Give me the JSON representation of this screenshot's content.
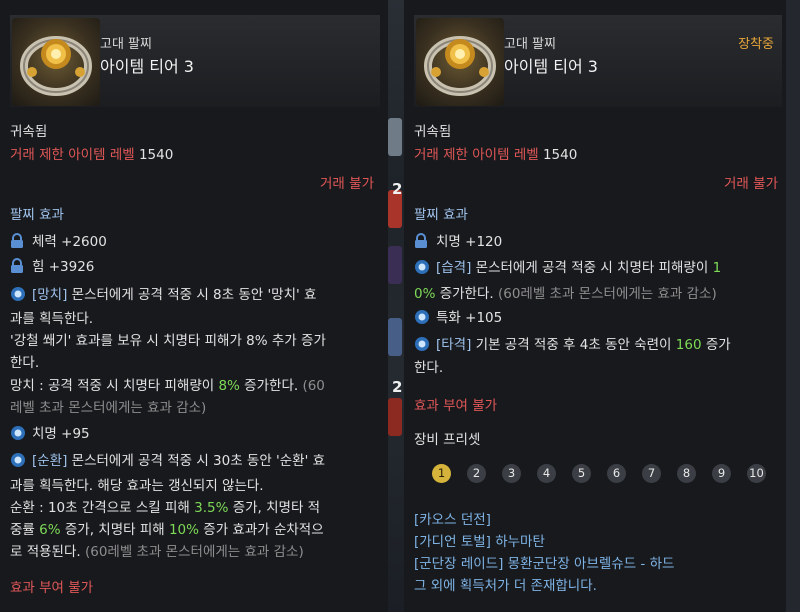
{
  "background": {
    "numbers": [
      "2",
      "2"
    ]
  },
  "left": {
    "category": "고대 팔찌",
    "tier": "아이템 티어 3",
    "bound": "귀속됨",
    "trade_level_label": "거래 제한 아이템 레벨",
    "trade_level_value": "1540",
    "trade_status": "거래 불가",
    "effects_header": "팔찌 효과",
    "stat1": "체력 +2600",
    "stat2": "힘 +3926",
    "e1_tag": "[망치]",
    "e1_text_a": " 몬스터에게 공격 적중 시 8초 동안 '망치' 효",
    "e1_text_b": "과를 획득한다.",
    "e1_text_c": "'강철 쐐기' 효과를 보유 시 치명타 피해가 8% 추가 증가",
    "e1_text_d": "한다.",
    "e1_text_e_pre": "망치 : 공격 적중 시 치명타 피해량이 ",
    "e1_text_e_val": "8%",
    "e1_text_e_post": " 증가한다.",
    "e1_text_e_note": " (60",
    "e1_text_f": "레벨 초과 몬스터에게는 효과 감소)",
    "stat3": "치명 +95",
    "e2_tag": "[순환]",
    "e2_text_a": " 몬스터에게 공격 적중 시 30초 동안 '순환' 효",
    "e2_text_b": "과를 획득한다. 해당 효과는 갱신되지 않는다.",
    "e2_text_c_pre": "순환 : 10초 간격으로 스킬 피해 ",
    "e2_text_c_val": "3.5%",
    "e2_text_c_post": " 증가, 치명타 적",
    "e2_text_d_pre": "중률 ",
    "e2_text_d_val1": "6%",
    "e2_text_d_mid": " 증가, 치명타 피해 ",
    "e2_text_d_val2": "10%",
    "e2_text_d_post": " 증가 효과가 순차적으",
    "e2_text_e": "로 적용된다.",
    "e2_text_e_note": " (60레벨 초과 몬스터에게는 효과 감소)",
    "reforge": "효과 부여 불가"
  },
  "right": {
    "category": "고대 팔찌",
    "tier": "아이템 티어 3",
    "equipped": "장착중",
    "bound": "귀속됨",
    "trade_level_label": "거래 제한 아이템 레벨",
    "trade_level_value": "1540",
    "trade_status": "거래 불가",
    "effects_header": "팔찌 효과",
    "stat1": "치명 +120",
    "e1_tag": "[습격]",
    "e1_text_a": " 몬스터에게 공격 적중 시 치명타 피해량이 ",
    "e1_val_a": "1",
    "e1_val_b": "0%",
    "e1_text_b": " 증가한다.",
    "e1_note": " (60레벨 초과 몬스터에게는 효과 감소)",
    "stat2": "특화 +105",
    "e2_tag": "[타격]",
    "e2_text_a": " 기본 공격 적중 후 4초 동안 숙련이 ",
    "e2_val": "160",
    "e2_text_b": " 증가",
    "e2_text_c": "한다.",
    "reforge": "효과 부여 불가",
    "preset_title": "장비 프리셋",
    "presets": [
      "1",
      "2",
      "3",
      "4",
      "5",
      "6",
      "7",
      "8",
      "9",
      "10"
    ],
    "sources": [
      "[카오스 던전]",
      "[가디언 토벌] 하누마탄",
      "[군단장 레이드] 몽환군단장 아브렐슈드 - 하드"
    ],
    "more_sources": "그 외에 획득처가 더 존재합니다."
  }
}
